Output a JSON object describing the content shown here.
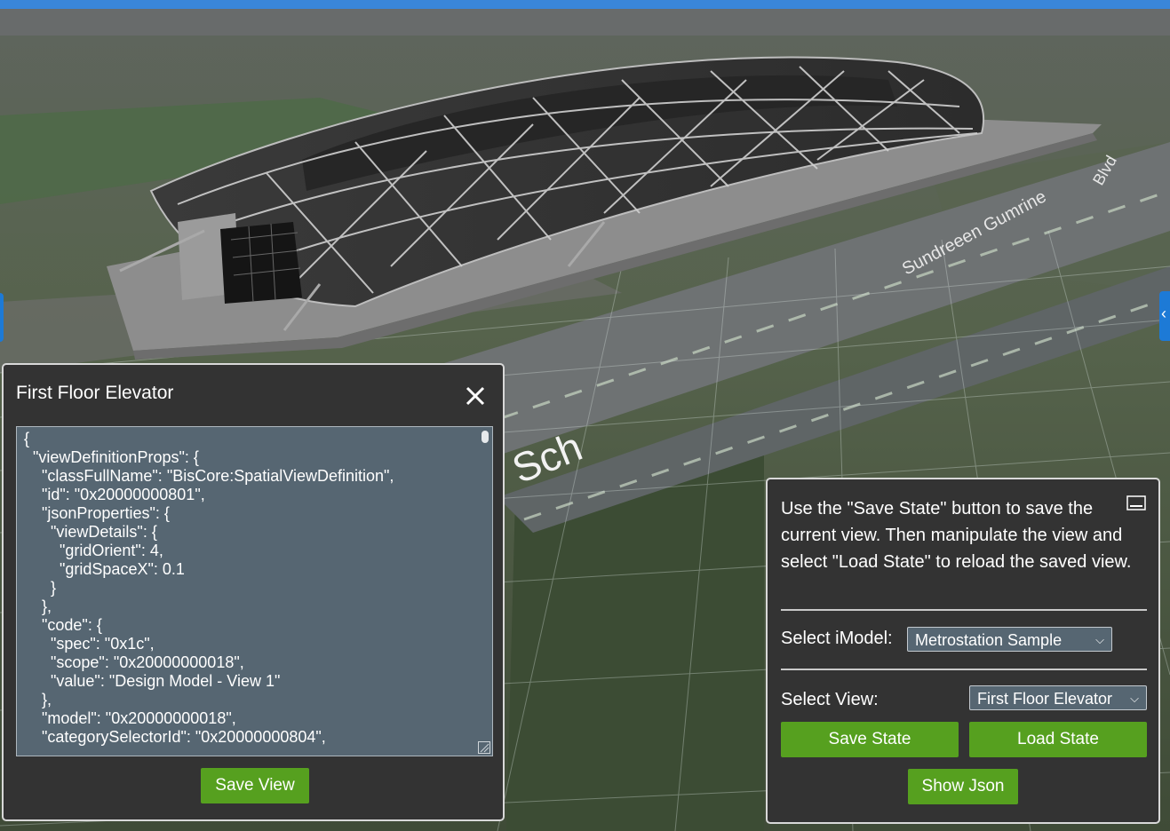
{
  "dialog": {
    "title": "First Floor Elevator",
    "json_text": "{\n  \"viewDefinitionProps\": {\n    \"classFullName\": \"BisCore:SpatialViewDefinition\",\n    \"id\": \"0x20000000801\",\n    \"jsonProperties\": {\n      \"viewDetails\": {\n        \"gridOrient\": 4,\n        \"gridSpaceX\": 0.1\n      }\n    },\n    \"code\": {\n      \"spec\": \"0x1c\",\n      \"scope\": \"0x20000000018\",\n      \"value\": \"Design Model - View 1\"\n    },\n    \"model\": \"0x20000000018\",\n    \"categorySelectorId\": \"0x20000000804\",",
    "save_view_label": "Save View"
  },
  "panel": {
    "instructions": "Use the \"Save State\" button to save the current view. Then manipulate the view and select \"Load State\" to reload the saved view.",
    "select_imodel_label": "Select iModel:",
    "imodel_value": "Metrostation Sample",
    "select_view_label": "Select View:",
    "view_value": "First Floor Elevator",
    "save_state_label": "Save State",
    "load_state_label": "Load State",
    "show_json_label": "Show Json"
  },
  "scene": {
    "road_label_1": "Sundreeen Gumrine",
    "road_label_2": "Sch",
    "road_label_3": "Blvd"
  },
  "icons": {
    "close": "close-icon",
    "minimize": "minimize-icon",
    "chevron": "chevron-down-icon",
    "expand": "expand-icon"
  },
  "colors": {
    "button_green": "#56a01f",
    "panel_bg": "#333333",
    "field_bg": "#566672",
    "accent_blue": "#1d7ad6"
  }
}
